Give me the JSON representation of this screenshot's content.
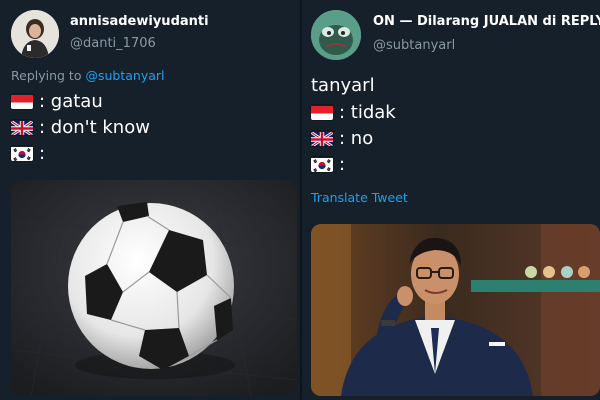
{
  "left_tweet": {
    "display_name": "annisadewiyudanti",
    "handle": "@danti_1706",
    "replying_prefix": "Replying to",
    "replying_mention": "@subtanyarl",
    "lines": [
      {
        "flag": "indonesia-flag-icon",
        "text": ": gatau"
      },
      {
        "flag": "uk-flag-icon",
        "text": ": don't know"
      },
      {
        "flag": "korea-flag-icon",
        "text": ":"
      }
    ],
    "media": "soccer-ball-photo"
  },
  "right_tweet": {
    "display_name": "ON — Dilarang JUALAN di REPLY MF",
    "handle": "@subtanyarl",
    "heading": "tanyarl",
    "lines": [
      {
        "flag": "indonesia-flag-icon",
        "text": ": tidak"
      },
      {
        "flag": "uk-flag-icon",
        "text": ": no"
      },
      {
        "flag": "korea-flag-icon",
        "text": ":"
      }
    ],
    "translate_label": "Translate Tweet",
    "media": "man-in-suit-photo"
  },
  "colors": {
    "background": "#15202b",
    "secondary_text": "#8899a6",
    "link": "#1da1f2",
    "avatar_right": "#5a9e8a"
  }
}
